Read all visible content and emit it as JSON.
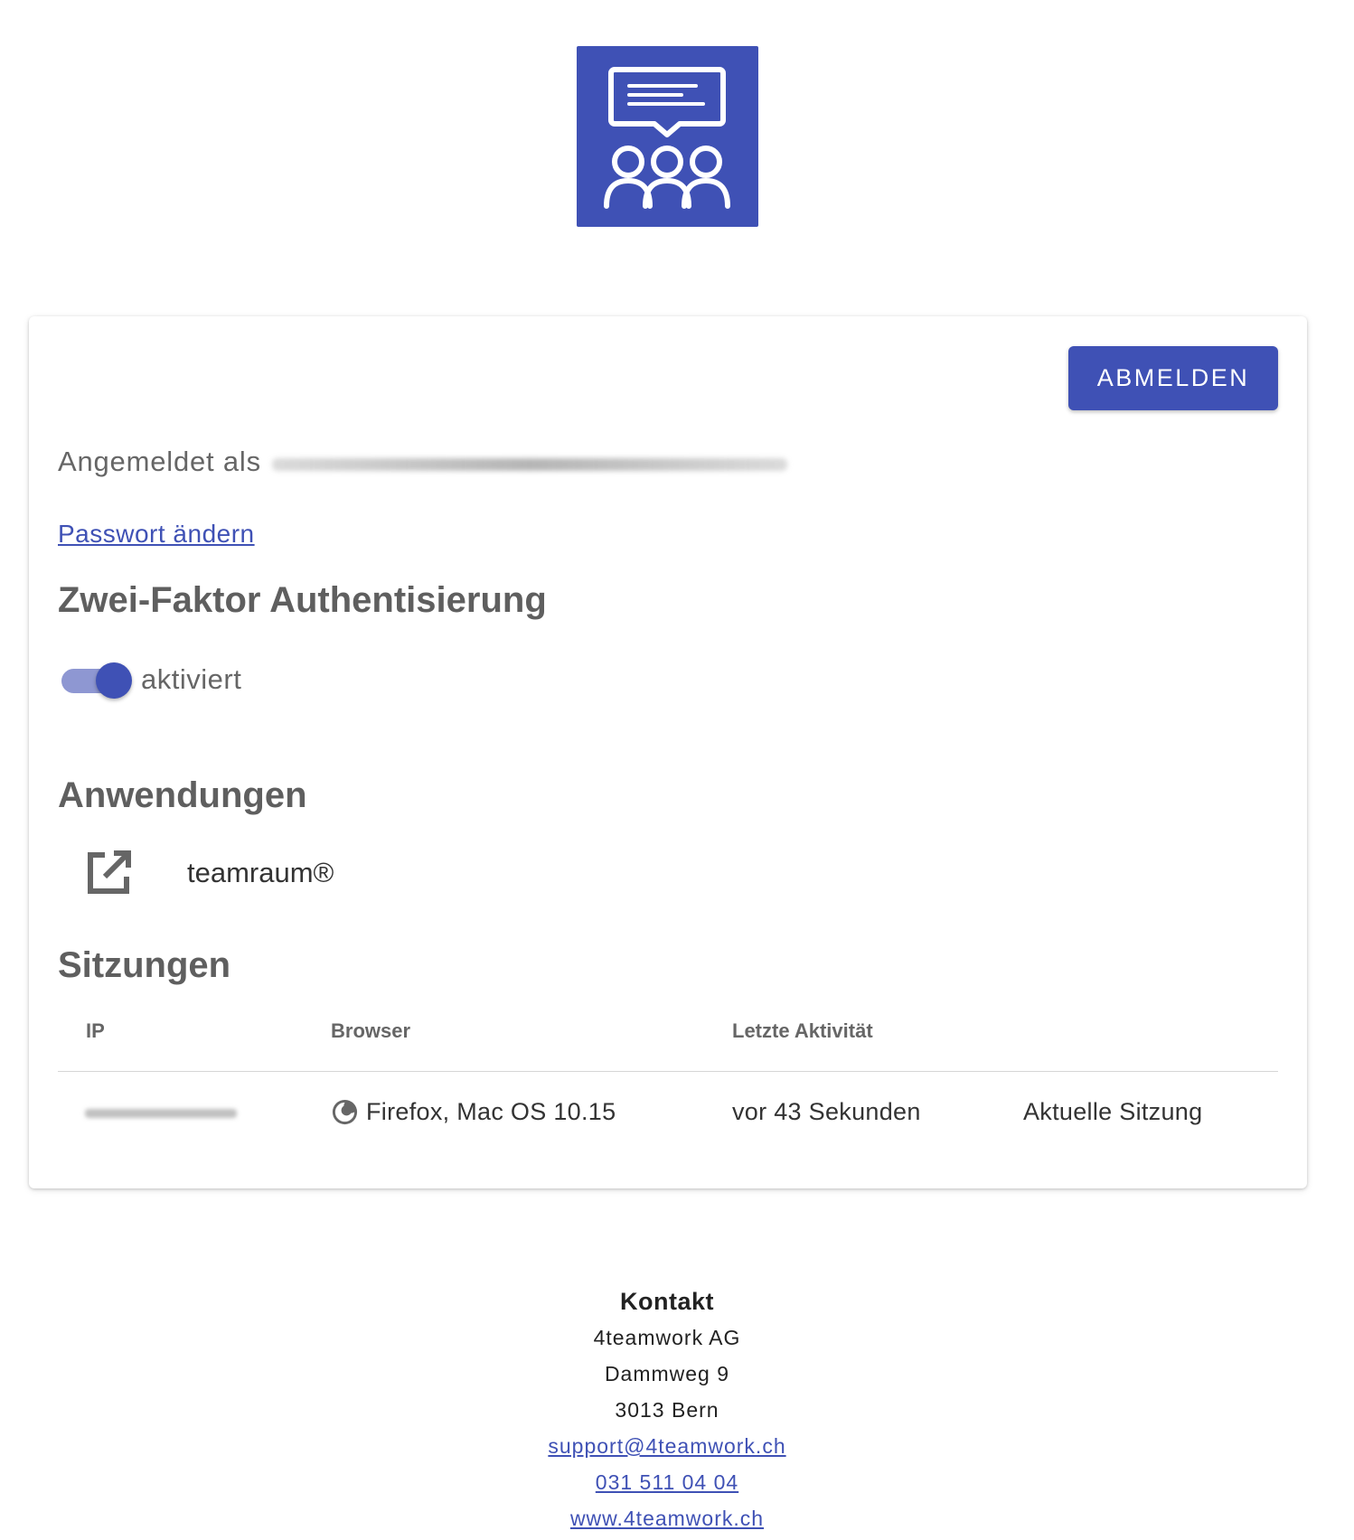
{
  "colors": {
    "primary": "#3f51b5",
    "toggle_track": "#8e97d2",
    "text": "#5f5f5f"
  },
  "header": {
    "logo_icon": "team-chat-icon"
  },
  "account": {
    "logout_label": "ABMELDEN",
    "signed_in_label": "Angemeldet als",
    "change_password_link": "Passwort ändern"
  },
  "two_factor": {
    "heading": "Zwei-Faktor Authentisierung",
    "enabled": true,
    "status_label": "aktiviert"
  },
  "applications": {
    "heading": "Anwendungen",
    "items": [
      {
        "icon": "open-in-new-icon",
        "name": "teamraum®"
      }
    ]
  },
  "sessions": {
    "heading": "Sitzungen",
    "columns": [
      "IP",
      "Browser",
      "Letzte Aktivität",
      ""
    ],
    "rows": [
      {
        "ip": "",
        "browser_icon": "firefox-icon",
        "browser": "Firefox, Mac OS 10.15",
        "last_activity": "vor 43 Sekunden",
        "note": "Aktuelle Sitzung"
      }
    ]
  },
  "contact": {
    "title": "Kontakt",
    "company": "4teamwork AG",
    "street": "Dammweg 9",
    "city": "3013 Bern",
    "email": "support@4teamwork.ch",
    "phone": "031 511 04 04",
    "website": "www.4teamwork.ch"
  }
}
